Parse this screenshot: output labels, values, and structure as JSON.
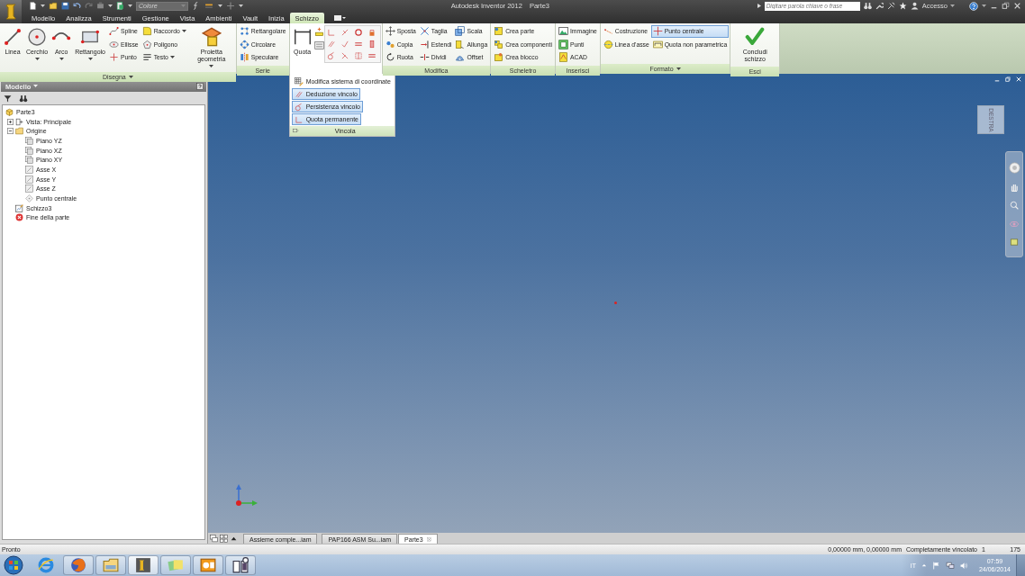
{
  "title_bar": {
    "style_combo": {
      "value": "Colore",
      "disabled": true
    },
    "app_name": "Autodesk Inventor 2012",
    "document": "Parte3",
    "search": {
      "placeholder": "Digitare parola chiave o frase"
    },
    "account": "Accesso"
  },
  "tabs": [
    {
      "label": "Modello",
      "selected": false
    },
    {
      "label": "Analizza",
      "selected": false
    },
    {
      "label": "Strumenti",
      "selected": false
    },
    {
      "label": "Gestione",
      "selected": false
    },
    {
      "label": "Vista",
      "selected": false
    },
    {
      "label": "Ambienti",
      "selected": false
    },
    {
      "label": "Vault",
      "selected": false
    },
    {
      "label": "Inizia",
      "selected": false
    },
    {
      "label": "Schizzo",
      "selected": true
    }
  ],
  "ribbon": {
    "panels": [
      {
        "title": "Disegna",
        "has_menu": true,
        "columns": [
          [
            {
              "label": "Linea",
              "kind": "large"
            }
          ],
          [
            {
              "label": "Cerchio",
              "kind": "large",
              "has_menu": true
            }
          ],
          [
            {
              "label": "Arco",
              "kind": "large",
              "has_menu": true
            }
          ],
          [
            {
              "label": "Rettangolo",
              "kind": "large",
              "has_menu": true
            }
          ],
          [
            {
              "label": "Spline",
              "kind": "small"
            },
            {
              "label": "Ellisse",
              "kind": "small"
            },
            {
              "label": "Punto",
              "kind": "small"
            }
          ],
          [
            {
              "label": "Raccordo",
              "kind": "small",
              "has_menu": true
            },
            {
              "label": "Poligono",
              "kind": "small"
            },
            {
              "label": "Testo",
              "kind": "small",
              "has_menu": true
            }
          ],
          [
            {
              "label": "Proietta geometria",
              "kind": "large",
              "has_menu": true
            }
          ]
        ]
      },
      {
        "title": "Serie",
        "columns": [
          [
            {
              "label": "Rettangolare",
              "kind": "small"
            },
            {
              "label": "Circolare",
              "kind": "small"
            },
            {
              "label": "Speculare",
              "kind": "small"
            }
          ]
        ]
      },
      {
        "title": "Vincola",
        "expanded": true,
        "columns": [
          [
            {
              "label": "Quota",
              "kind": "large"
            }
          ],
          [
            {
              "kind": "icon_pair"
            }
          ],
          [
            {
              "kind": "icon_grid"
            }
          ]
        ],
        "menu_items": [
          {
            "label": "Modifica sistema di coordinate",
            "on": false
          },
          {
            "label": "Deduzione vincolo",
            "on": true
          },
          {
            "label": "Persistenza vincolo",
            "on": true
          },
          {
            "label": "Quota permanente",
            "on": true
          }
        ]
      },
      {
        "title": "Modifica",
        "columns": [
          [
            {
              "label": "Sposta",
              "kind": "small"
            },
            {
              "label": "Copia",
              "kind": "small"
            },
            {
              "label": "Ruota",
              "kind": "small"
            }
          ],
          [
            {
              "label": "Taglia",
              "kind": "small"
            },
            {
              "label": "Estendi",
              "kind": "small"
            },
            {
              "label": "Dividi",
              "kind": "small"
            }
          ],
          [
            {
              "label": "Scala",
              "kind": "small"
            },
            {
              "label": "Allunga",
              "kind": "small"
            },
            {
              "label": "Offset",
              "kind": "small"
            }
          ]
        ]
      },
      {
        "title": "Scheletro",
        "columns": [
          [
            {
              "label": "Crea parte",
              "kind": "small"
            },
            {
              "label": "Crea componenti",
              "kind": "small"
            },
            {
              "label": "Crea blocco",
              "kind": "small"
            }
          ]
        ]
      },
      {
        "title": "Inserisci",
        "columns": [
          [
            {
              "label": "Immagine",
              "kind": "small"
            },
            {
              "label": "Punti",
              "kind": "small"
            },
            {
              "label": "ACAD",
              "kind": "small"
            }
          ]
        ]
      },
      {
        "title": "Formato",
        "has_menu": true,
        "columns": [
          [
            {
              "label": "Costruzione",
              "kind": "small",
              "on": false
            },
            {
              "label": "Linea d'asse",
              "kind": "small",
              "on": false
            }
          ],
          [
            {
              "label": "Punto centrale",
              "kind": "small",
              "on": true
            },
            {
              "label": "Quota non parametrica",
              "kind": "small",
              "on": false
            }
          ]
        ]
      },
      {
        "title": "Esci",
        "columns": [
          [
            {
              "label": "Concludi schizzo",
              "kind": "large"
            }
          ]
        ]
      }
    ]
  },
  "browser": {
    "title": "Modello",
    "tree": [
      {
        "label": "Parte3",
        "kind": "part",
        "children": [
          {
            "label": "Vista: Principale",
            "kind": "view",
            "expanded": false
          },
          {
            "label": "Origine",
            "kind": "folder",
            "expanded": true,
            "children": [
              {
                "label": "Piano YZ",
                "kind": "plane"
              },
              {
                "label": "Piano XZ",
                "kind": "plane"
              },
              {
                "label": "Piano XY",
                "kind": "plane"
              },
              {
                "label": "Asse X",
                "kind": "axis"
              },
              {
                "label": "Asse Y",
                "kind": "axis"
              },
              {
                "label": "Asse Z",
                "kind": "axis"
              },
              {
                "label": "Punto centrale",
                "kind": "point"
              }
            ]
          },
          {
            "label": "Schizzo3",
            "kind": "sketch"
          },
          {
            "label": "Fine della parte",
            "kind": "end"
          }
        ]
      }
    ]
  },
  "viewport": {
    "view_cube_face": "DESTRA"
  },
  "document_tabs": [
    {
      "label": "Assieme comple...iam",
      "selected": false
    },
    {
      "label": "PAP166 ASM Su...iam",
      "selected": false
    },
    {
      "label": "Parte3",
      "selected": true
    }
  ],
  "status_bar": {
    "message": "Pronto",
    "coordinates": "0,00000 mm, 0,00000 mm",
    "constraint_status": "Completamente vincolato",
    "field_1": "1",
    "field_2": "175"
  },
  "taskbar": {
    "apps": [
      {
        "running": false,
        "active": false
      },
      {
        "running": true,
        "active": false
      },
      {
        "running": true,
        "active": false
      },
      {
        "running": true,
        "active": true
      },
      {
        "running": true,
        "active": false
      },
      {
        "running": true,
        "active": false
      },
      {
        "running": true,
        "active": false
      }
    ],
    "language": "IT",
    "time": "07:59",
    "date": "24/06/2014"
  }
}
